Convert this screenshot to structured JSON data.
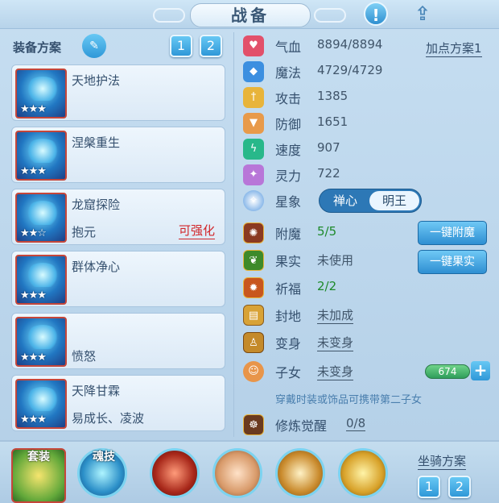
{
  "title": "战备",
  "left": {
    "plan_label": "装备方案",
    "plan_tabs": [
      "1",
      "2"
    ],
    "items": [
      {
        "name": "天地护法",
        "sub": "",
        "stars": "★★★",
        "upgrade": ""
      },
      {
        "name": "涅槃重生",
        "sub": "",
        "stars": "★★★",
        "upgrade": ""
      },
      {
        "name": "龙窟探险",
        "sub": "抱元",
        "stars": "★★☆",
        "upgrade": "可强化"
      },
      {
        "name": "群体净心",
        "sub": "",
        "stars": "★★★",
        "upgrade": ""
      },
      {
        "name": "",
        "sub": "愤怒",
        "stars": "★★★",
        "upgrade": ""
      },
      {
        "name": "天降甘霖",
        "sub": "易成长、凌波",
        "stars": "★★★",
        "upgrade": ""
      }
    ]
  },
  "stats": {
    "plan_link": "加点方案1",
    "rows": [
      {
        "label": "气血",
        "value": "8894/8894",
        "color": "#e2506a"
      },
      {
        "label": "魔法",
        "value": "4729/4729",
        "color": "#3c8fe0"
      },
      {
        "label": "攻击",
        "value": "1385",
        "color": "#e8b43a"
      },
      {
        "label": "防御",
        "value": "1651",
        "color": "#e89a4a"
      },
      {
        "label": "速度",
        "value": "907",
        "color": "#28b88a"
      },
      {
        "label": "灵力",
        "value": "722",
        "color": "#b876d8"
      }
    ],
    "xingxiang_label": "星象",
    "xingxiang_opts": [
      "禅心",
      "明王"
    ]
  },
  "extras": {
    "fumo_label": "附魔",
    "fumo_value": "5/5",
    "fumo_btn": "一键附魔",
    "guoshi_label": "果实",
    "guoshi_value": "未使用",
    "guoshi_btn": "一键果实",
    "qifu_label": "祈福",
    "qifu_value": "2/2",
    "fengdi_label": "封地",
    "fengdi_value": "未加成",
    "bianshen_label": "变身",
    "bianshen_value": "未变身",
    "zinv_label": "子女",
    "zinv_value": "未变身",
    "zinv_bar": "674",
    "hint": "穿戴时装或饰品可携带第二子女",
    "xiulian_label": "修炼觉醒",
    "xiulian_value": "0/8"
  },
  "bottom": {
    "suit_label": "套装",
    "soul_label": "魂技",
    "mount_label": "坐骑方案",
    "mount_tabs": [
      "1",
      "2"
    ]
  },
  "colors": {
    "accent": "#2f98d8",
    "red": "#d2262a",
    "green": "#1d8a2a"
  }
}
